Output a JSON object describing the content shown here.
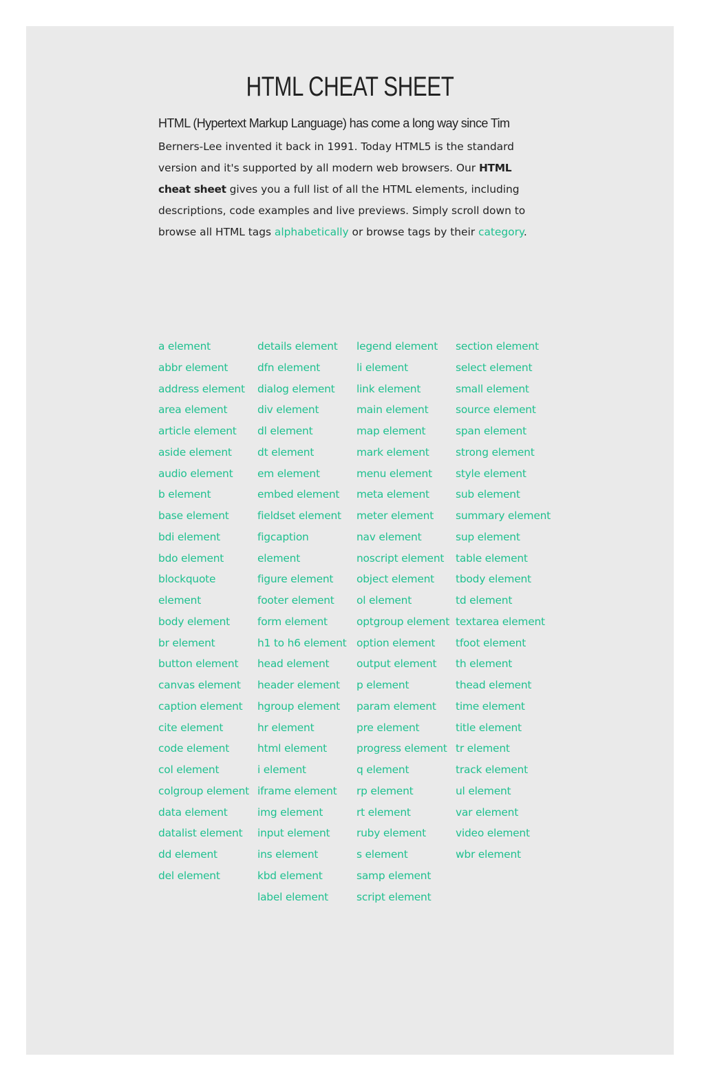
{
  "page": {
    "title": "HTML CHEAT SHEET",
    "accent_color": "#1ec08f",
    "panel_color": "#eaeaea",
    "text_color": "#222222"
  },
  "intro": {
    "first_line": "HTML (Hypertext Markup Language) has come a long way since Tim",
    "part1": "Berners-Lee invented it back in 1991. Today HTML5 is the standard version and it's supported by all modern web browsers. Our ",
    "bold": "HTML cheat sheet",
    "part2": " gives you a full list of all the HTML elements, including descriptions, code examples and live previews. Simply scroll down to browse all HTML tags ",
    "link_alphabetically": "alphabetically",
    "part3": " or browse tags by their ",
    "link_category": "category",
    "part4": "."
  },
  "elements": {
    "columns": [
      [
        "a element",
        "abbr element",
        "address element",
        "area element",
        "article element",
        "aside element",
        "audio element",
        "b element",
        "base element",
        "bdi element",
        "bdo element",
        "blockquote element",
        "body element",
        "br element",
        "button element",
        "canvas element",
        "caption element",
        "cite element",
        "code element",
        "col element",
        "colgroup element",
        "data element",
        "datalist element",
        "dd element",
        "del element"
      ],
      [
        "details element",
        "dfn element",
        "dialog element",
        "div element",
        "dl element",
        "dt element",
        "em element",
        "embed element",
        "fieldset element",
        "figcaption element",
        "figure element",
        "footer element",
        "form element",
        "h1 to h6 element",
        "head element",
        "header element",
        "hgroup element",
        "hr element",
        "html element",
        "i element",
        "iframe element",
        "img element",
        "input element",
        "ins element",
        "kbd element",
        "label element"
      ],
      [
        "legend element",
        "li element",
        "link element",
        "main element",
        "map element",
        "mark element",
        "menu element",
        "meta element",
        "meter element",
        "nav element",
        "noscript element",
        "object element",
        "ol element",
        "optgroup element",
        "option element",
        "output element",
        "p element",
        "param element",
        "pre element",
        "progress element",
        "q element",
        "rp element",
        "rt element",
        "ruby element",
        "s element",
        "samp element",
        "script element"
      ],
      [
        "section element",
        "select element",
        "small element",
        "source element",
        "span element",
        "strong element",
        "style element",
        "sub element",
        "summary element",
        "sup element",
        "table element",
        "tbody element",
        "td element",
        "textarea element",
        "tfoot element",
        "th element",
        "thead element",
        "time element",
        "title element",
        "tr element",
        "track element",
        "ul element",
        "var element",
        "video element",
        "wbr element"
      ]
    ]
  }
}
